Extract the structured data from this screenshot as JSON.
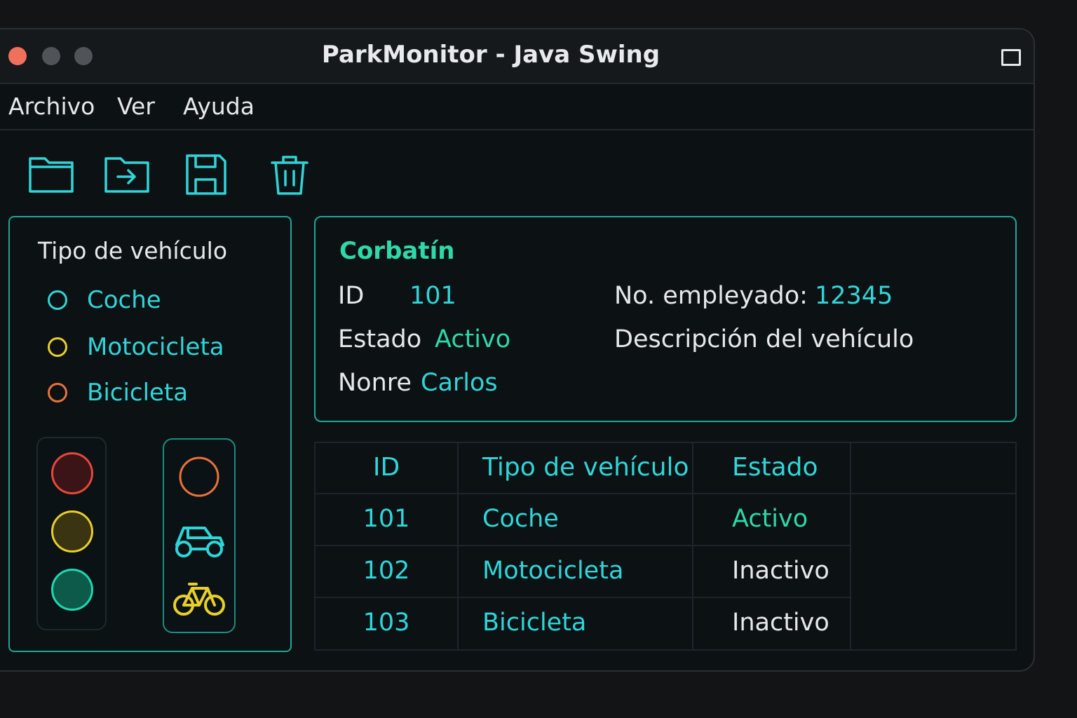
{
  "window": {
    "title": "ParkMonitor - Java Swing"
  },
  "menu": [
    "Archivo",
    "Ver",
    "Ayuda"
  ],
  "toolbar": [
    {
      "icon": "folder-icon",
      "action": "open"
    },
    {
      "icon": "folder-arrow-icon",
      "action": "import"
    },
    {
      "icon": "save-icon",
      "action": "save"
    },
    {
      "icon": "trash-icon",
      "action": "delete"
    }
  ],
  "vehicle_panel": {
    "title": "Tipo de vehículo",
    "options": [
      {
        "label": "Coche",
        "color": "#2fd5d8"
      },
      {
        "label": "Motocicleta",
        "color": "#e8cf2a"
      },
      {
        "label": "Bicicleta",
        "color": "#e8733a"
      }
    ],
    "traffic_light_colors": [
      "#e8473a",
      "#e8cf2a",
      "#1fd8b0"
    ],
    "vehicle_icons": [
      "circle-icon",
      "car-icon",
      "bicycle-icon"
    ]
  },
  "info": {
    "heading": "Corbatín",
    "id_label": "ID",
    "id_value": "101",
    "employee_label": "No. empleyado:",
    "employee_value": "12345",
    "status_label": "Estado",
    "status_value": "Activo",
    "description_label": "Descripción del vehículo",
    "name_label": "Nonre",
    "name_value": "Carlos"
  },
  "table": {
    "headers": [
      "ID",
      "Tipo de vehículo",
      "Estado"
    ],
    "rows": [
      {
        "id": "101",
        "type": "Coche",
        "status": "Activo"
      },
      {
        "id": "102",
        "type": "Motocicleta",
        "status": "Inactivo"
      },
      {
        "id": "103",
        "type": "Bicicleta",
        "status": "Inactivo"
      }
    ]
  }
}
